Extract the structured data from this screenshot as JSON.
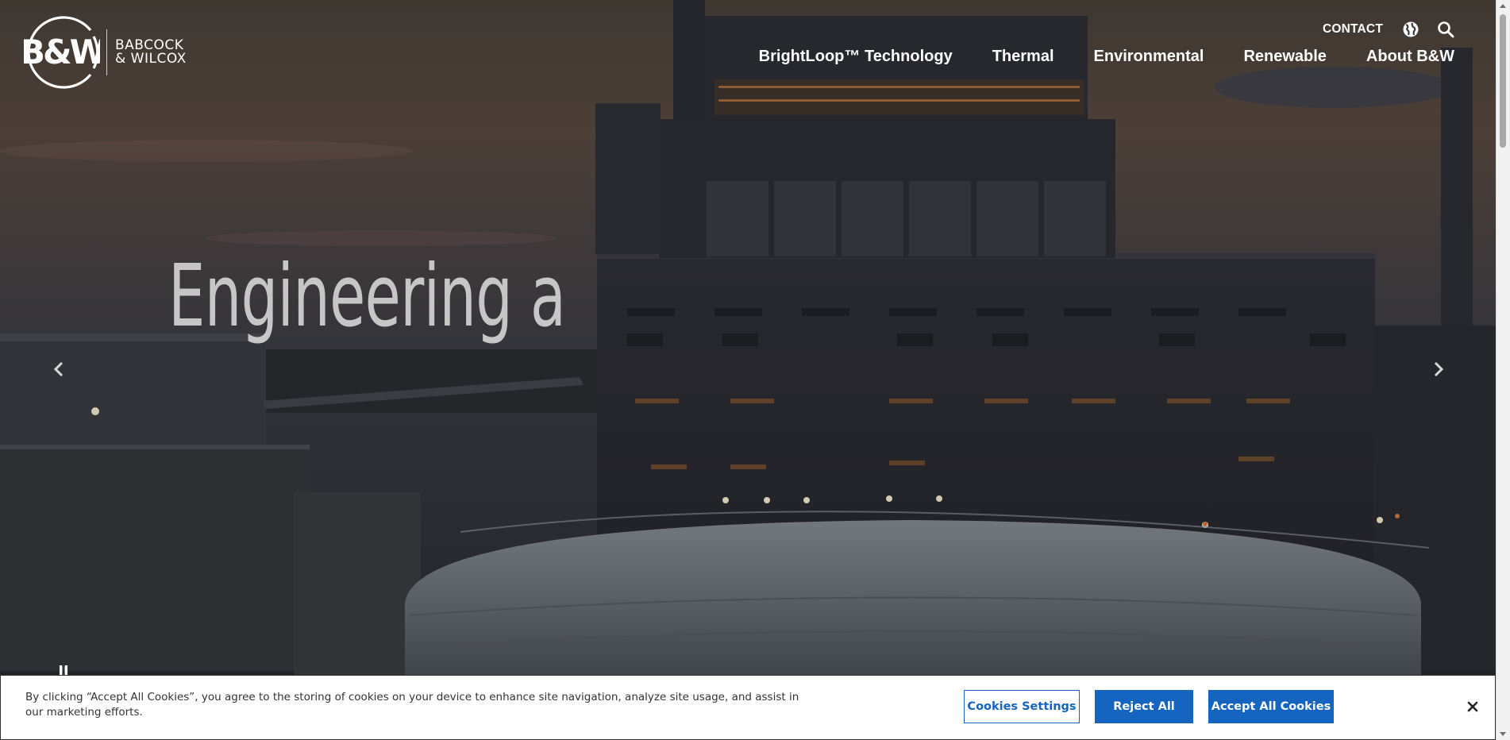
{
  "brand": {
    "mark": "B&W",
    "name_line1": "BABCOCK",
    "name_line2": "& WILCOX"
  },
  "utility_nav": {
    "contact_label": "CONTACT",
    "globe_icon": "globe-icon",
    "search_icon": "search-icon"
  },
  "main_nav": {
    "items": [
      {
        "label": "BrightLoop™ Technology"
      },
      {
        "label": "Thermal"
      },
      {
        "label": "Environmental"
      },
      {
        "label": "Renewable"
      },
      {
        "label": "About B&W"
      }
    ]
  },
  "hero": {
    "headline": "Engineering a",
    "prev_icon": "chevron-left-icon",
    "next_icon": "chevron-right-icon",
    "pause_icon": "pause-icon"
  },
  "cookie_banner": {
    "text": "By clicking “Accept All Cookies”, you agree to the storing of cookies on your device to enhance site navigation, analyze site usage, and assist in our marketing efforts.",
    "settings_label": "Cookies Settings",
    "reject_label": "Reject All",
    "accept_label": "Accept All Cookies",
    "close_icon": "close-icon"
  },
  "colors": {
    "accent_blue": "#1565c0",
    "banner_bg": "#ffffff",
    "nav_text": "#ffffff"
  }
}
